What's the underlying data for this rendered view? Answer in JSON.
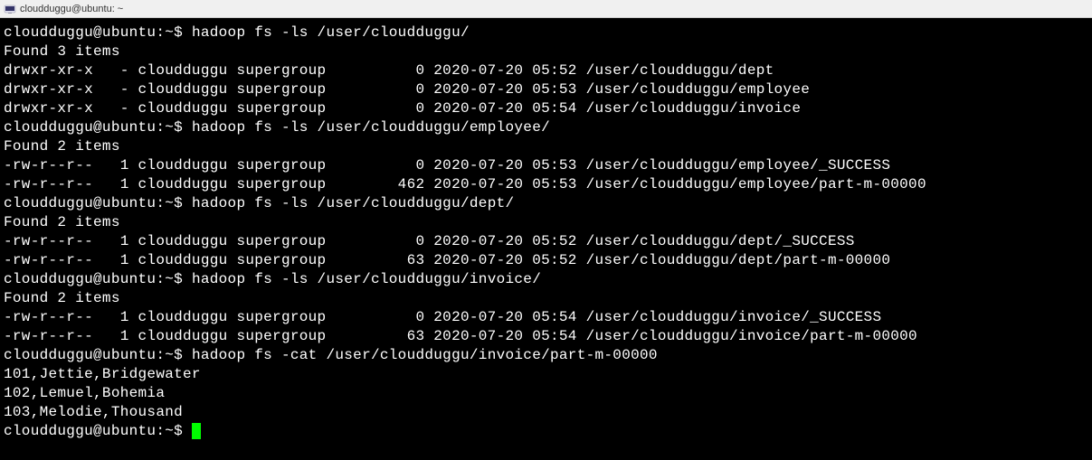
{
  "window": {
    "title": "cloudduggu@ubuntu: ~"
  },
  "prompt": "cloudduggu@ubuntu:~$ ",
  "session": [
    {
      "type": "cmd",
      "text": "hadoop fs -ls /user/cloudduggu/"
    },
    {
      "type": "out",
      "text": "Found 3 items"
    },
    {
      "type": "out",
      "text": "drwxr-xr-x   - cloudduggu supergroup          0 2020-07-20 05:52 /user/cloudduggu/dept"
    },
    {
      "type": "out",
      "text": "drwxr-xr-x   - cloudduggu supergroup          0 2020-07-20 05:53 /user/cloudduggu/employee"
    },
    {
      "type": "out",
      "text": "drwxr-xr-x   - cloudduggu supergroup          0 2020-07-20 05:54 /user/cloudduggu/invoice"
    },
    {
      "type": "cmd",
      "text": "hadoop fs -ls /user/cloudduggu/employee/"
    },
    {
      "type": "out",
      "text": "Found 2 items"
    },
    {
      "type": "out",
      "text": "-rw-r--r--   1 cloudduggu supergroup          0 2020-07-20 05:53 /user/cloudduggu/employee/_SUCCESS"
    },
    {
      "type": "out",
      "text": "-rw-r--r--   1 cloudduggu supergroup        462 2020-07-20 05:53 /user/cloudduggu/employee/part-m-00000"
    },
    {
      "type": "cmd",
      "text": "hadoop fs -ls /user/cloudduggu/dept/"
    },
    {
      "type": "out",
      "text": "Found 2 items"
    },
    {
      "type": "out",
      "text": "-rw-r--r--   1 cloudduggu supergroup          0 2020-07-20 05:52 /user/cloudduggu/dept/_SUCCESS"
    },
    {
      "type": "out",
      "text": "-rw-r--r--   1 cloudduggu supergroup         63 2020-07-20 05:52 /user/cloudduggu/dept/part-m-00000"
    },
    {
      "type": "cmd",
      "text": "hadoop fs -ls /user/cloudduggu/invoice/"
    },
    {
      "type": "out",
      "text": "Found 2 items"
    },
    {
      "type": "out",
      "text": "-rw-r--r--   1 cloudduggu supergroup          0 2020-07-20 05:54 /user/cloudduggu/invoice/_SUCCESS"
    },
    {
      "type": "out",
      "text": "-rw-r--r--   1 cloudduggu supergroup         63 2020-07-20 05:54 /user/cloudduggu/invoice/part-m-00000"
    },
    {
      "type": "cmd",
      "text": "hadoop fs -cat /user/cloudduggu/invoice/part-m-00000"
    },
    {
      "type": "out",
      "text": "101,Jettie,Bridgewater"
    },
    {
      "type": "out",
      "text": "102,Lemuel,Bohemia"
    },
    {
      "type": "out",
      "text": "103,Melodie,Thousand"
    },
    {
      "type": "cmd",
      "text": "",
      "cursor": true
    }
  ]
}
